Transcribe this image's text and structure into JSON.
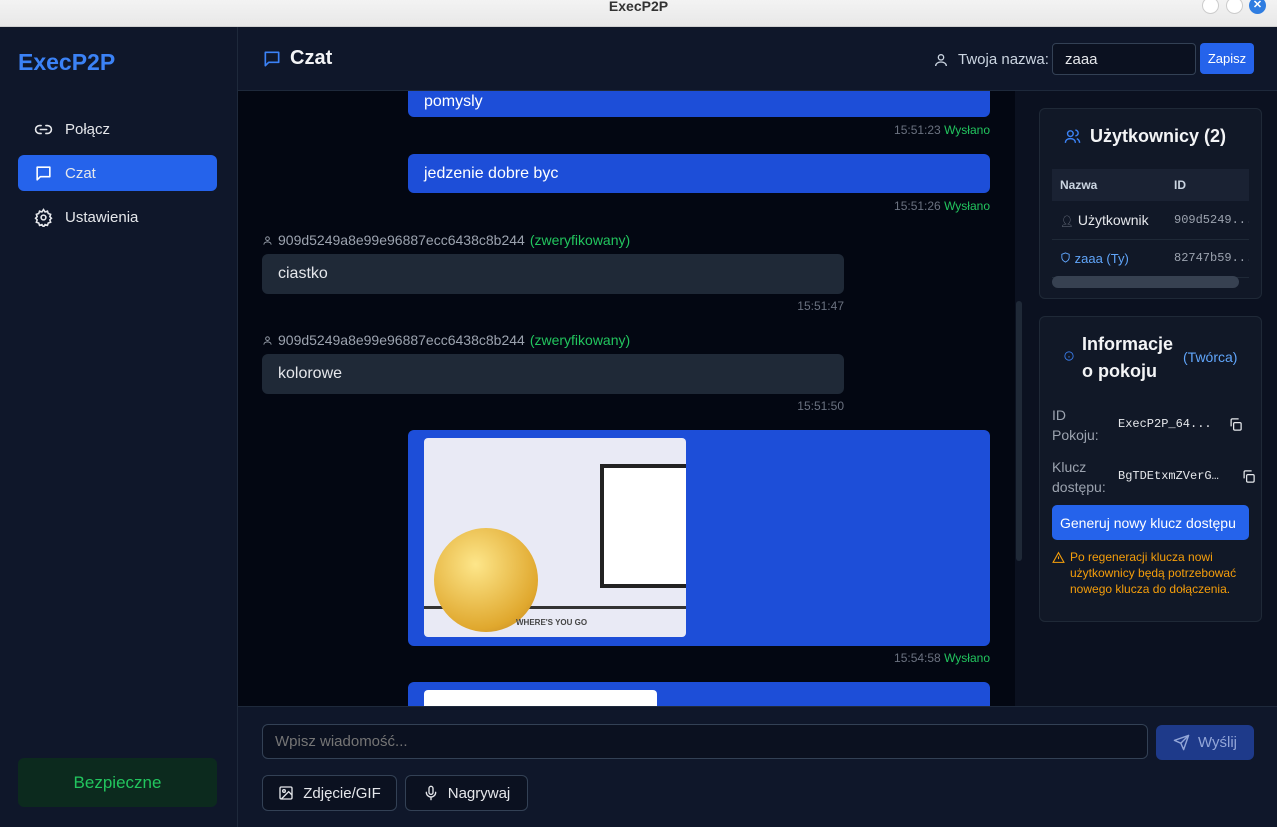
{
  "window": {
    "title": "ExecP2P"
  },
  "sidebar": {
    "brand": "ExecP2P",
    "items": [
      {
        "label": "Połącz",
        "icon": "link-icon"
      },
      {
        "label": "Czat",
        "icon": "chat-icon",
        "active": true
      },
      {
        "label": "Ustawienia",
        "icon": "gear-icon"
      }
    ],
    "status": "Bezpieczne"
  },
  "header": {
    "title": "Czat",
    "username_label": "Twoja nazwa:",
    "username_value": "zaaa",
    "save_label": "Zapisz"
  },
  "messages": [
    {
      "type": "out",
      "text": "pomysly",
      "time": "15:51:23",
      "status": "Wysłano"
    },
    {
      "type": "out",
      "text": "jedzenie dobre byc",
      "time": "15:51:26",
      "status": "Wysłano"
    },
    {
      "type": "in",
      "sender": "909d5249a8e99e96887ecc6438c8b244",
      "verified": "(zweryfikowany)",
      "text": "ciastko",
      "time": "15:51:47"
    },
    {
      "type": "in",
      "sender": "909d5249a8e99e96887ecc6438c8b244",
      "verified": "(zweryfikowany)",
      "text": "kolorowe",
      "time": "15:51:50"
    },
    {
      "type": "out-image",
      "caption": "WHERE'S YOU GO",
      "time": "15:54:58",
      "status": "Wysłano"
    }
  ],
  "composer": {
    "placeholder": "Wpisz wiadomość...",
    "send_label": "Wyślij",
    "image_label": "Zdjęcie/GIF",
    "record_label": "Nagrywaj"
  },
  "users_panel": {
    "title": "Użytkownicy (2)",
    "columns": [
      "Nazwa",
      "ID"
    ],
    "rows": [
      {
        "name": "Użytkownik",
        "id": "909d5249..."
      },
      {
        "name": "zaaa (Ty)",
        "id": "82747b59..."
      }
    ]
  },
  "room_panel": {
    "title": "Informacje o pokoju",
    "role": "(Twórca)",
    "room_id_label": "ID Pokoju:",
    "room_id_value": "ExecP2P_64...",
    "key_label": "Klucz dostępu:",
    "key_value": "BgTDEtxmZVerG…",
    "regen_label": "Generuj nowy klucz dostępu",
    "warning": "Po regeneracji klucza nowi użytkownicy będą potrzebować nowego klucza do dołączenia."
  },
  "colors": {
    "accent": "#2563eb",
    "success": "#22c55e",
    "warning": "#f59e0b"
  }
}
